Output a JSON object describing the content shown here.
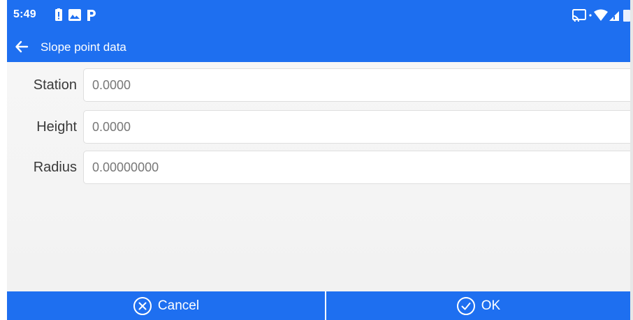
{
  "status_bar": {
    "time": "5:49",
    "left_icons": [
      "battery-alert-icon",
      "image-icon",
      "parking-icon"
    ],
    "right_icons": [
      "cast-icon",
      "wifi-icon",
      "signal-icon",
      "battery-icon"
    ]
  },
  "app_bar": {
    "title": "Slope point data",
    "back_icon": "arrow-left-icon"
  },
  "form": {
    "station": {
      "label": "Station",
      "value": "0.0000"
    },
    "height": {
      "label": "Height",
      "value": "0.0000"
    },
    "radius": {
      "label": "Radius",
      "value": "0.00000000"
    }
  },
  "buttons": {
    "cancel": {
      "label": "Cancel",
      "icon": "close-circle-icon"
    },
    "ok": {
      "label": "OK",
      "icon": "check-circle-icon"
    }
  },
  "colors": {
    "primary": "#1e6ff0",
    "background": "#f4f4f4",
    "input_border": "#dedede",
    "label_text": "#3a3a3a",
    "value_text": "#777777"
  }
}
